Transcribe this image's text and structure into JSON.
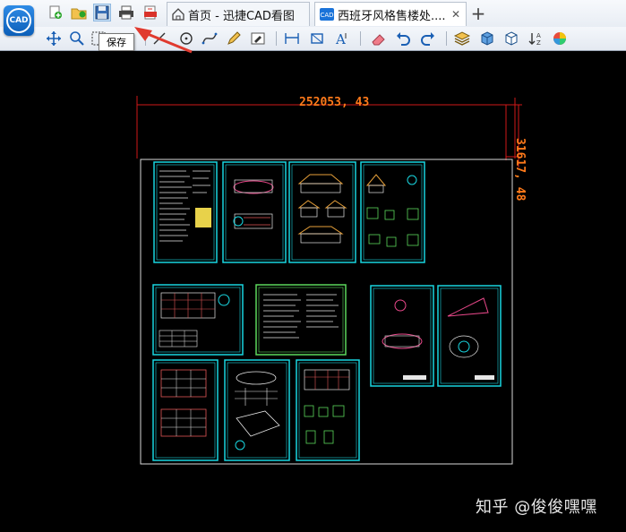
{
  "app": {
    "logo_text": "CAD"
  },
  "tabs": [
    {
      "label": "首页 - 迅捷CAD看图"
    },
    {
      "label": "西班牙风格售楼处...."
    }
  ],
  "tooltip": {
    "text": "保存"
  },
  "drawing": {
    "dim_width": "252053, 43",
    "dim_height": "31617, 48"
  },
  "watermark": "知乎 @俊俊嘿嘿",
  "colors": {
    "accent": "#1a73d9",
    "arrow": "#e03a2f",
    "dimension": "#ff7a1a",
    "sheet_border": "#19d6e0"
  }
}
